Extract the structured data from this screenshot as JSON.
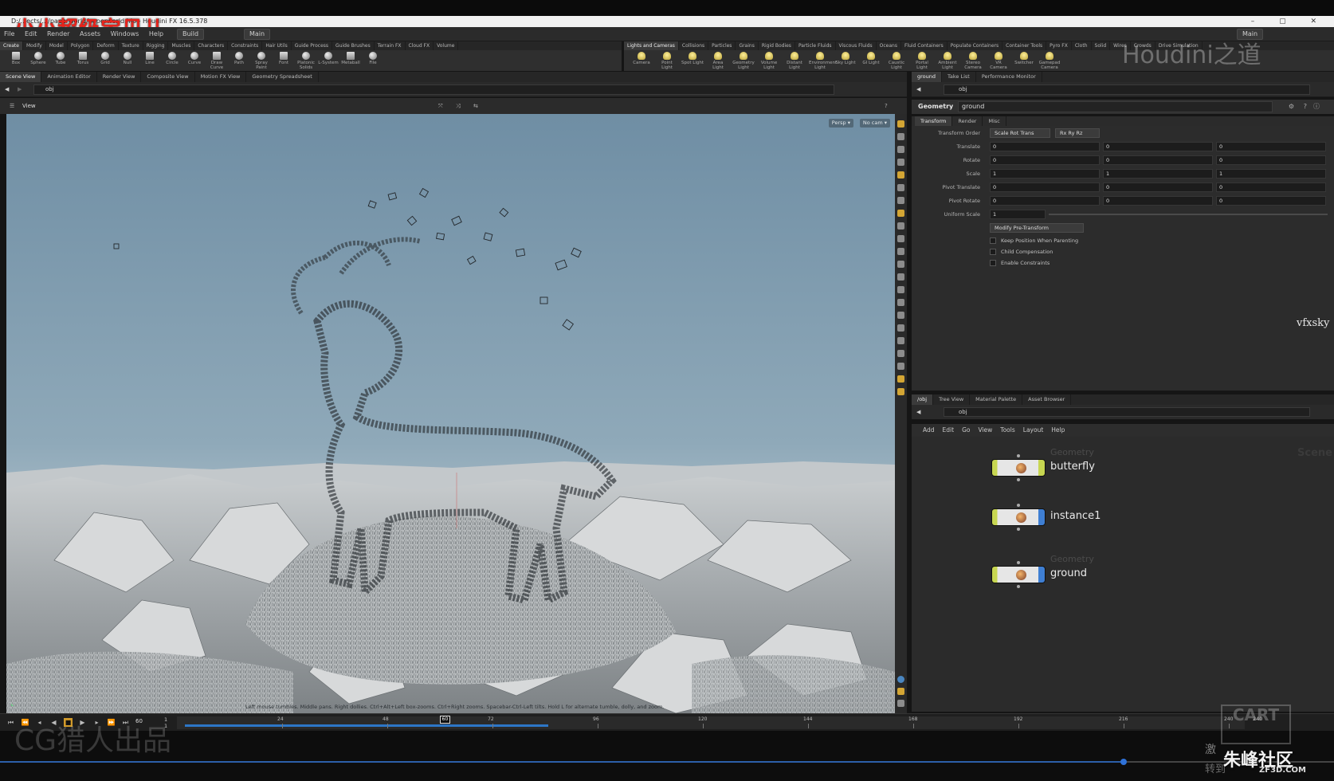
{
  "window": {
    "title": "D:/...ects/.../paperworld/paperworld.hip - Houdini FX 16.5.378",
    "controls": "–  ▢  ✕"
  },
  "watermarks": {
    "top_left": "小小超级宝贝儿",
    "houdini_logo": "Houdini之道",
    "bottom_left": "CG猎人出品",
    "cart": "CART",
    "zhufeng": "朱峰社区",
    "zf3d": "ZF3D.COM",
    "jili": "激",
    "zhuandao": "转到",
    "vfxsky": "vfxsky"
  },
  "menubar": {
    "items": [
      "File",
      "Edit",
      "Render",
      "Assets",
      "Windows",
      "Help"
    ],
    "desktop": "Build",
    "desktop_right": "Main",
    "main_left": "Main"
  },
  "shelf_left": {
    "tabs": [
      "Create",
      "Modify",
      "Model",
      "Polygon",
      "Deform",
      "Texture",
      "Rigging",
      "Muscles",
      "Characters",
      "Constraints",
      "Hair Utils",
      "Guide Process",
      "Guide Brushes",
      "Terrain FX",
      "Cloud FX",
      "Volume"
    ],
    "tools": [
      "Box",
      "Sphere",
      "Tube",
      "Torus",
      "Grid",
      "Null",
      "Line",
      "Circle",
      "Curve",
      "Draw Curve",
      "Path",
      "Spray Paint",
      "Font",
      "Platonic Solids",
      "L-System",
      "Metaball",
      "File"
    ]
  },
  "shelf_right": {
    "tabs": [
      "Lights and Cameras",
      "Collisions",
      "Particles",
      "Grains",
      "Rigid Bodies",
      "Particle Fluids",
      "Viscous Fluids",
      "Oceans",
      "Fluid Containers",
      "Populate Containers",
      "Container Tools",
      "Pyro FX",
      "Cloth",
      "Solid",
      "Wires",
      "Crowds",
      "Drive Simulation"
    ],
    "tools": [
      "Camera",
      "Point Light",
      "Spot Light",
      "Area Light",
      "Geometry Light",
      "Volume Light",
      "Distant Light",
      "Environment Light",
      "Sky Light",
      "GI Light",
      "Caustic Light",
      "Portal Light",
      "Ambient Light",
      "Stereo Camera",
      "VR Camera",
      "Switcher",
      "Gamepad Camera"
    ]
  },
  "left_panes": {
    "tabs": [
      "Scene View",
      "Animation Editor",
      "Render View",
      "Composite View",
      "Motion FX View",
      "Geometry Spreadsheet"
    ],
    "path": "obj",
    "view_label": "View",
    "persp": "Persp ▾",
    "cam": "No cam ▾",
    "hint": "Left mouse tumbles. Middle pans. Right dollies. Ctrl+Alt+Left box-zooms. Ctrl+Right zooms. Spacebar-Ctrl-Left tilts. Hold L for alternate tumble, dolly, and zoom."
  },
  "params": {
    "tabs": [
      "ground",
      "Take List",
      "Performance Monitor"
    ],
    "path": "obj",
    "node_type": "Geometry",
    "node_name": "ground",
    "subtabs": [
      "Transform",
      "Render",
      "Misc"
    ],
    "transform_order_label": "Transform Order",
    "transform_order": "Scale Rot Trans",
    "rot_order": "Rx Ry Rz",
    "rows": [
      {
        "label": "Translate",
        "v": [
          "0",
          "0",
          "0"
        ]
      },
      {
        "label": "Rotate",
        "v": [
          "0",
          "0",
          "0"
        ]
      },
      {
        "label": "Scale",
        "v": [
          "1",
          "1",
          "1"
        ]
      },
      {
        "label": "Pivot Translate",
        "v": [
          "0",
          "0",
          "0"
        ]
      },
      {
        "label": "Pivot Rotate",
        "v": [
          "0",
          "0",
          "0"
        ]
      }
    ],
    "uniform_scale_label": "Uniform Scale",
    "uniform_scale": "1",
    "modify_pre": "Modify Pre-Transform",
    "checks": [
      "Keep Position When Parenting",
      "Child Compensation",
      "Enable Constraints"
    ]
  },
  "network": {
    "tabs": [
      "/obj",
      "Tree View",
      "Material Palette",
      "Asset Browser"
    ],
    "path": "obj",
    "menu": [
      "Add",
      "Edit",
      "Go",
      "View",
      "Tools",
      "Layout",
      "Help"
    ],
    "scene_label": "Scene",
    "nodes": [
      {
        "type": "Geometry",
        "name": "butterfly"
      },
      {
        "type": "",
        "name": "instance1"
      },
      {
        "type": "Geometry",
        "name": "ground"
      }
    ]
  },
  "timeline": {
    "current_frame": "60",
    "start": "1",
    "start2": "1",
    "ticks": [
      "24",
      "48",
      "72",
      "96",
      "120",
      "144",
      "168",
      "192",
      "216",
      "240"
    ],
    "cursor": "60",
    "end": "240",
    "cache_fraction": 0.34,
    "cursor_fraction": 0.246
  },
  "colors": {
    "cache_bar": "#2d76c7",
    "node_geo": "#c7d651",
    "node_selected": "#3f7fd3",
    "accent_red": "#e8241c"
  }
}
